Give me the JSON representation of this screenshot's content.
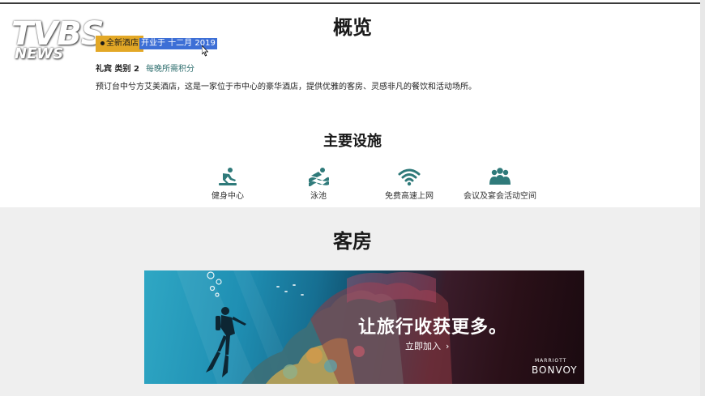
{
  "watermark": {
    "brand": "TVBS",
    "sub": "NEWS"
  },
  "overview": {
    "title": "概览",
    "badge": "全新酒店",
    "opened": "开业于 十二月 2019",
    "elite_label": "礼宾 类别 2",
    "elite_link": "每晚所需积分",
    "description": "预订台中兮方艾美酒店，这是一家位于市中心的豪华酒店，提供优雅的客房、灵感非凡的餐饮和活动场所。"
  },
  "amenities": {
    "title": "主要设施",
    "items": [
      {
        "label": "健身中心",
        "icon": "fitness-icon"
      },
      {
        "label": "泳池",
        "icon": "pool-icon"
      },
      {
        "label": "免费高速上网",
        "icon": "wifi-icon"
      },
      {
        "label": "会议及宴会活动空间",
        "icon": "meeting-icon"
      }
    ]
  },
  "rooms": {
    "title": "客房",
    "banner": {
      "headline": "让旅行收获更多。",
      "cta": "立即加入",
      "brand_small": "MARRIOTT",
      "brand_big": "BONVOY"
    }
  },
  "colors": {
    "accent_teal": "#2f7a7a",
    "badge_gold": "#e3a826",
    "selection_blue": "#3d6fd6"
  }
}
